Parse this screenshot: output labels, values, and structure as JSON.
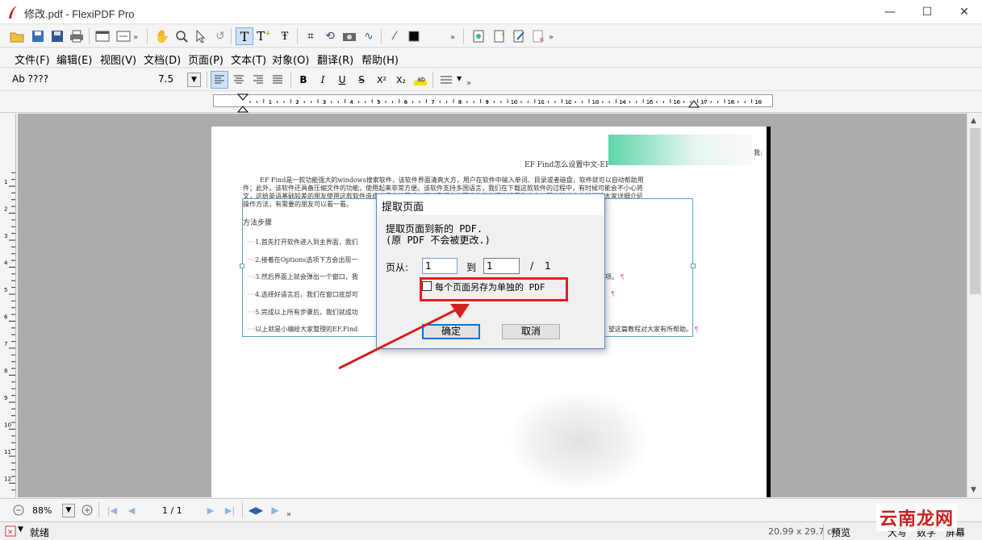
{
  "window": {
    "title": "修改.pdf - FlexiPDF Pro"
  },
  "toolbar1": {
    "color_label": "颜色"
  },
  "menu": [
    "文件(F)",
    "编辑(E)",
    "视图(V)",
    "文档(D)",
    "页面(P)",
    "文本(T)",
    "对象(O)",
    "翻译(R)",
    "帮助(H)"
  ],
  "format": {
    "font_name": "Ab ????",
    "font_size": "7.5",
    "bold": "B",
    "italic": "I",
    "underline": "U",
    "strike": "S",
    "superscript": "X²",
    "subscript": "X₂"
  },
  "ruler": {
    "h_ticks": [
      "1",
      "2",
      "3",
      "4",
      "5",
      "6",
      "7",
      "8",
      "9",
      "10",
      "11",
      "12",
      "13",
      "14",
      "15",
      "16",
      "17",
      "18",
      "19"
    ],
    "v_ticks": [
      "1",
      "2",
      "3",
      "4",
      "5",
      "6",
      "7",
      "8",
      "9",
      "10",
      "11",
      "12"
    ]
  },
  "document": {
    "heading": "EF Find怎么设置中文-EF",
    "heading_right": "我:",
    "intro_line1": "EF Find是一款功能强大的windows搜索软件，该软件界面清爽大方，用户在软件中输入单词、目录或者磁盘，软件就可以自动帮助用户查找特定的文",
    "intro_line2": "件；此外，该软件还具备压缩文件的功能，使用起来非常方便。该软件支持多国语言，我们在下载这款软件的过程中，有时候可能会不小心将界面语言设置为英",
    "intro_line3": "文，这给英语基础较差的朋友使用这款软件造成了很大的困难，所以我们有必要将软件的语言设置为中文，那么接下来小编就给大家详细介绍一下EF Find中文的具体",
    "intro_line4": "操作方法，有需要的朋友可以看一看。",
    "steps_title": "方法步骤",
    "step1": "1.首先打开软件进入到主界面，我们",
    "step2": "2.接着在Options选项下方会出现一",
    "step3": "3.然后界面上就会弹出一个窗口，我",
    "step3_tail": "项。",
    "step4": "4.选择好语言后，我们在窗口底部可",
    "step5": "5.完成以上所有步骤后，我们就成功",
    "closing": "以上就是小编给大家整理的EF.Find",
    "closing_tail": "望这篇教程对大家有所帮助。"
  },
  "dialog": {
    "title": "提取页面",
    "line1": "提取页面到新的 PDF.",
    "line2": "(原 PDF 不会被更改.)",
    "from_label": "页从:",
    "from_value": "1",
    "to_label": "到",
    "to_value": "1",
    "slash": "/",
    "total": "1",
    "checkbox_label": "每个页面另存为单独的 PDF",
    "ok_label": "确定",
    "cancel_label": "取消"
  },
  "nav": {
    "zoom": "88%",
    "page_indicator": "1 / 1"
  },
  "status": {
    "ready": "就绪",
    "page_size": "20.99 x 29.7 cm",
    "preview": "预览",
    "caps": "大写",
    "num": "数字",
    "screen": "屏幕"
  },
  "watermark": {
    "text": "云南龙网"
  },
  "colors": {
    "accent": "#2b5eab",
    "highlight_box": "#e02020",
    "arrow": "#d42020",
    "watermark": "#c8201f"
  }
}
